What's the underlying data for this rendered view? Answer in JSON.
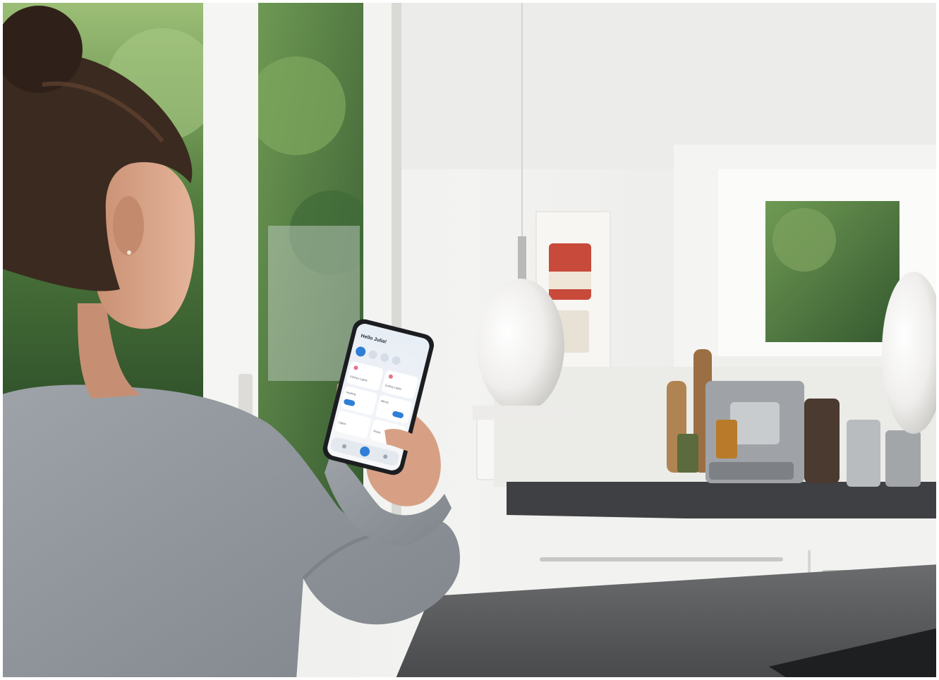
{
  "image": {
    "subject": "woman-using-smart-home-app-in-kitchen"
  },
  "phone_app": {
    "greeting": "Hello Julia!",
    "tiles": [
      {
        "label": "Kitchen Lights"
      },
      {
        "label": "Ceiling Lights"
      },
      {
        "label": "Heating"
      },
      {
        "label": "Blinds"
      },
      {
        "label": "Lights"
      },
      {
        "label": "Music"
      }
    ]
  },
  "colors": {
    "sweater": "#8f959b",
    "hair": "#3b2a20",
    "counter": "#4b4d50",
    "accent_blue": "#2f7fd6",
    "foliage": "#4f7a3c",
    "lamp": "#f1f0ee"
  },
  "icons": [
    "home-icon",
    "rooms-icon",
    "devices-icon",
    "profile-icon"
  ]
}
